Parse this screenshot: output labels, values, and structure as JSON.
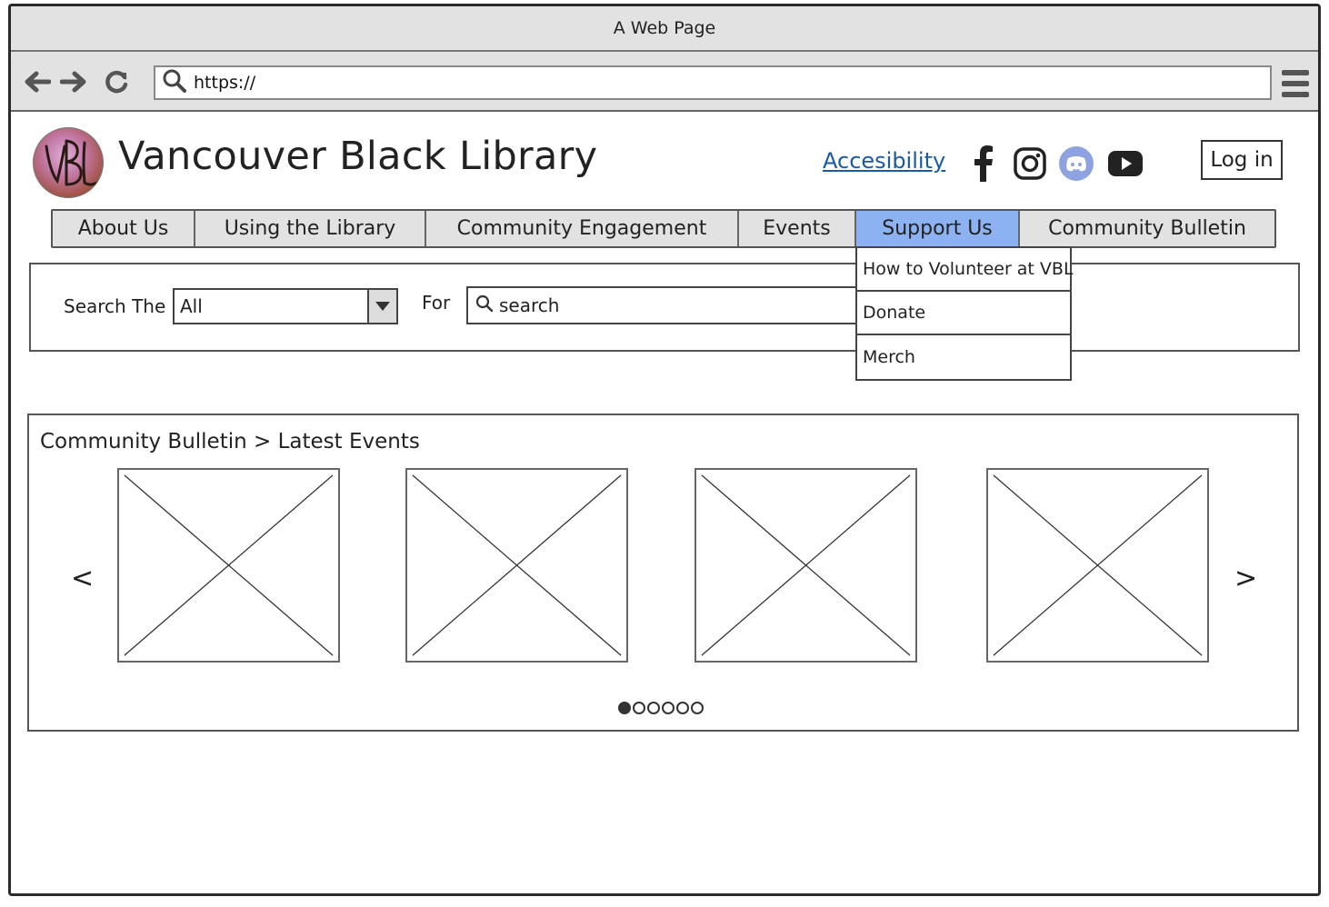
{
  "window": {
    "title": "A Web Page"
  },
  "browser": {
    "url": "https://",
    "back_icon": "arrow-left-icon",
    "forward_icon": "arrow-right-icon",
    "reload_icon": "reload-icon",
    "menu_icon": "hamburger-menu-icon"
  },
  "header": {
    "site_title": "Vancouver Black Library",
    "logo_icon": "vbl-logo",
    "accessibility_link": "Accesibility",
    "social": [
      "facebook-icon",
      "instagram-icon",
      "discord-icon",
      "youtube-icon"
    ],
    "login_label": "Log in"
  },
  "nav": {
    "tabs": [
      {
        "label": "About Us"
      },
      {
        "label": "Using the Library"
      },
      {
        "label": "Community Engagement"
      },
      {
        "label": "Events"
      },
      {
        "label": "Support Us",
        "active": true
      },
      {
        "label": "Community Bulletin"
      }
    ],
    "dropdown": [
      {
        "label": "How to Volunteer at VBL"
      },
      {
        "label": "Donate"
      },
      {
        "label": "Merch"
      }
    ]
  },
  "search": {
    "label": "Search The",
    "scope_value": "All",
    "for_label": "For",
    "placeholder": "search"
  },
  "bulletin": {
    "title": "Community Bulletin > Latest Events",
    "prev": "<",
    "next": ">",
    "card_count": 4,
    "page_count": 6,
    "active_page": 1
  },
  "colors": {
    "active_tab": "#8db2f2",
    "link": "#1a5aa0",
    "chrome": "#e2e2e2",
    "discord": "#8ea1e1"
  }
}
